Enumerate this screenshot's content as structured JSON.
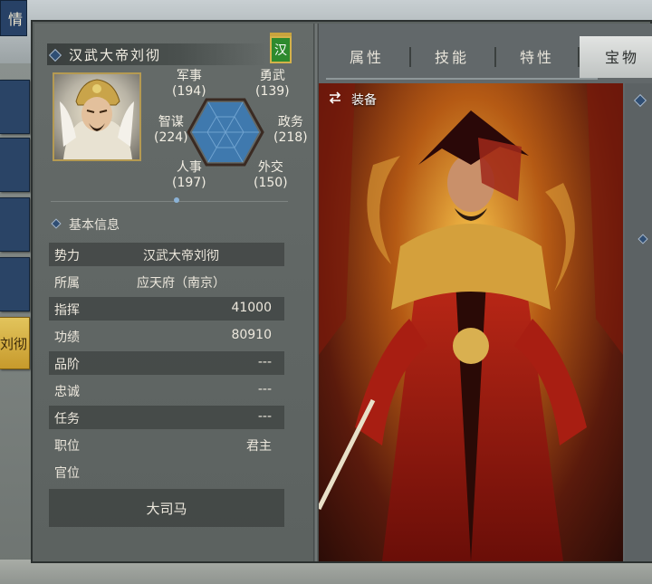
{
  "side_tabs": {
    "top": "情",
    "active": "刘彻"
  },
  "character": {
    "name": "汉武大帝刘彻",
    "faction_badge": "汉"
  },
  "stats": {
    "military": {
      "label": "军事",
      "value": "(194)"
    },
    "valor": {
      "label": "勇武",
      "value": "(139)"
    },
    "intelligence": {
      "label": "智谋",
      "value": "(224)"
    },
    "politics": {
      "label": "政务",
      "value": "(218)"
    },
    "personnel": {
      "label": "人事",
      "value": "(197)"
    },
    "diplomacy": {
      "label": "外交",
      "value": "(150)"
    }
  },
  "basic_info": {
    "title": "基本信息",
    "rows": [
      {
        "key": "势力",
        "value": "汉武大帝刘彻"
      },
      {
        "key": "所属",
        "value": "应天府（南京）"
      },
      {
        "key": "指挥",
        "value": "41000"
      },
      {
        "key": "功绩",
        "value": "80910"
      },
      {
        "key": "品阶",
        "value": "---"
      },
      {
        "key": "忠诚",
        "value": "---"
      },
      {
        "key": "任务",
        "value": "---"
      },
      {
        "key": "职位",
        "value": "君主"
      },
      {
        "key": "官位",
        "value": ""
      }
    ],
    "official_title": "大司马"
  },
  "tabs": [
    "属性",
    "技能",
    "特性",
    "宝物"
  ],
  "equipment": {
    "label": "装备"
  },
  "colors": {
    "accent_gold": "#c9a43e",
    "panel": "#5b615f",
    "hex_fill": "#3f79ae"
  }
}
